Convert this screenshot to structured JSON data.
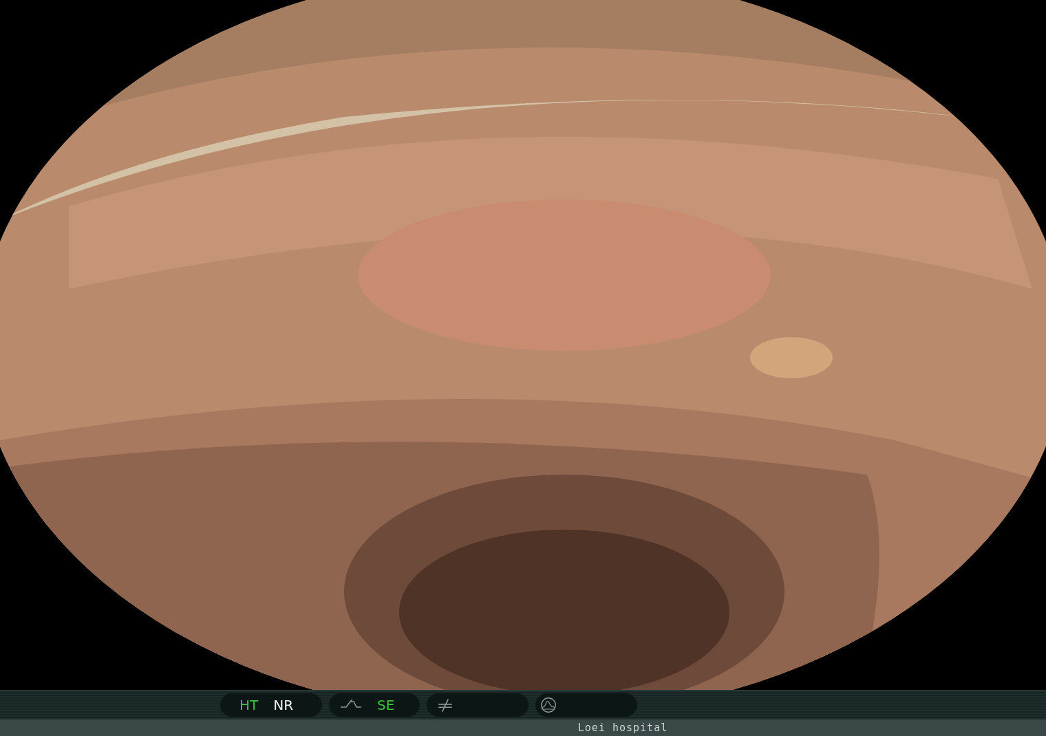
{
  "status_bar": {
    "groups": [
      {
        "items": [
          {
            "kind": "label",
            "text": "HT",
            "on": true
          },
          {
            "kind": "label",
            "text": "NR",
            "on": false
          }
        ]
      },
      {
        "items": [
          {
            "kind": "curve"
          },
          {
            "kind": "label",
            "text": "SE",
            "on": true
          }
        ]
      },
      {
        "items": [
          {
            "kind": "slash"
          }
        ]
      },
      {
        "items": [
          {
            "kind": "wave"
          }
        ]
      }
    ]
  },
  "footer": {
    "text": "Loei hospital"
  }
}
